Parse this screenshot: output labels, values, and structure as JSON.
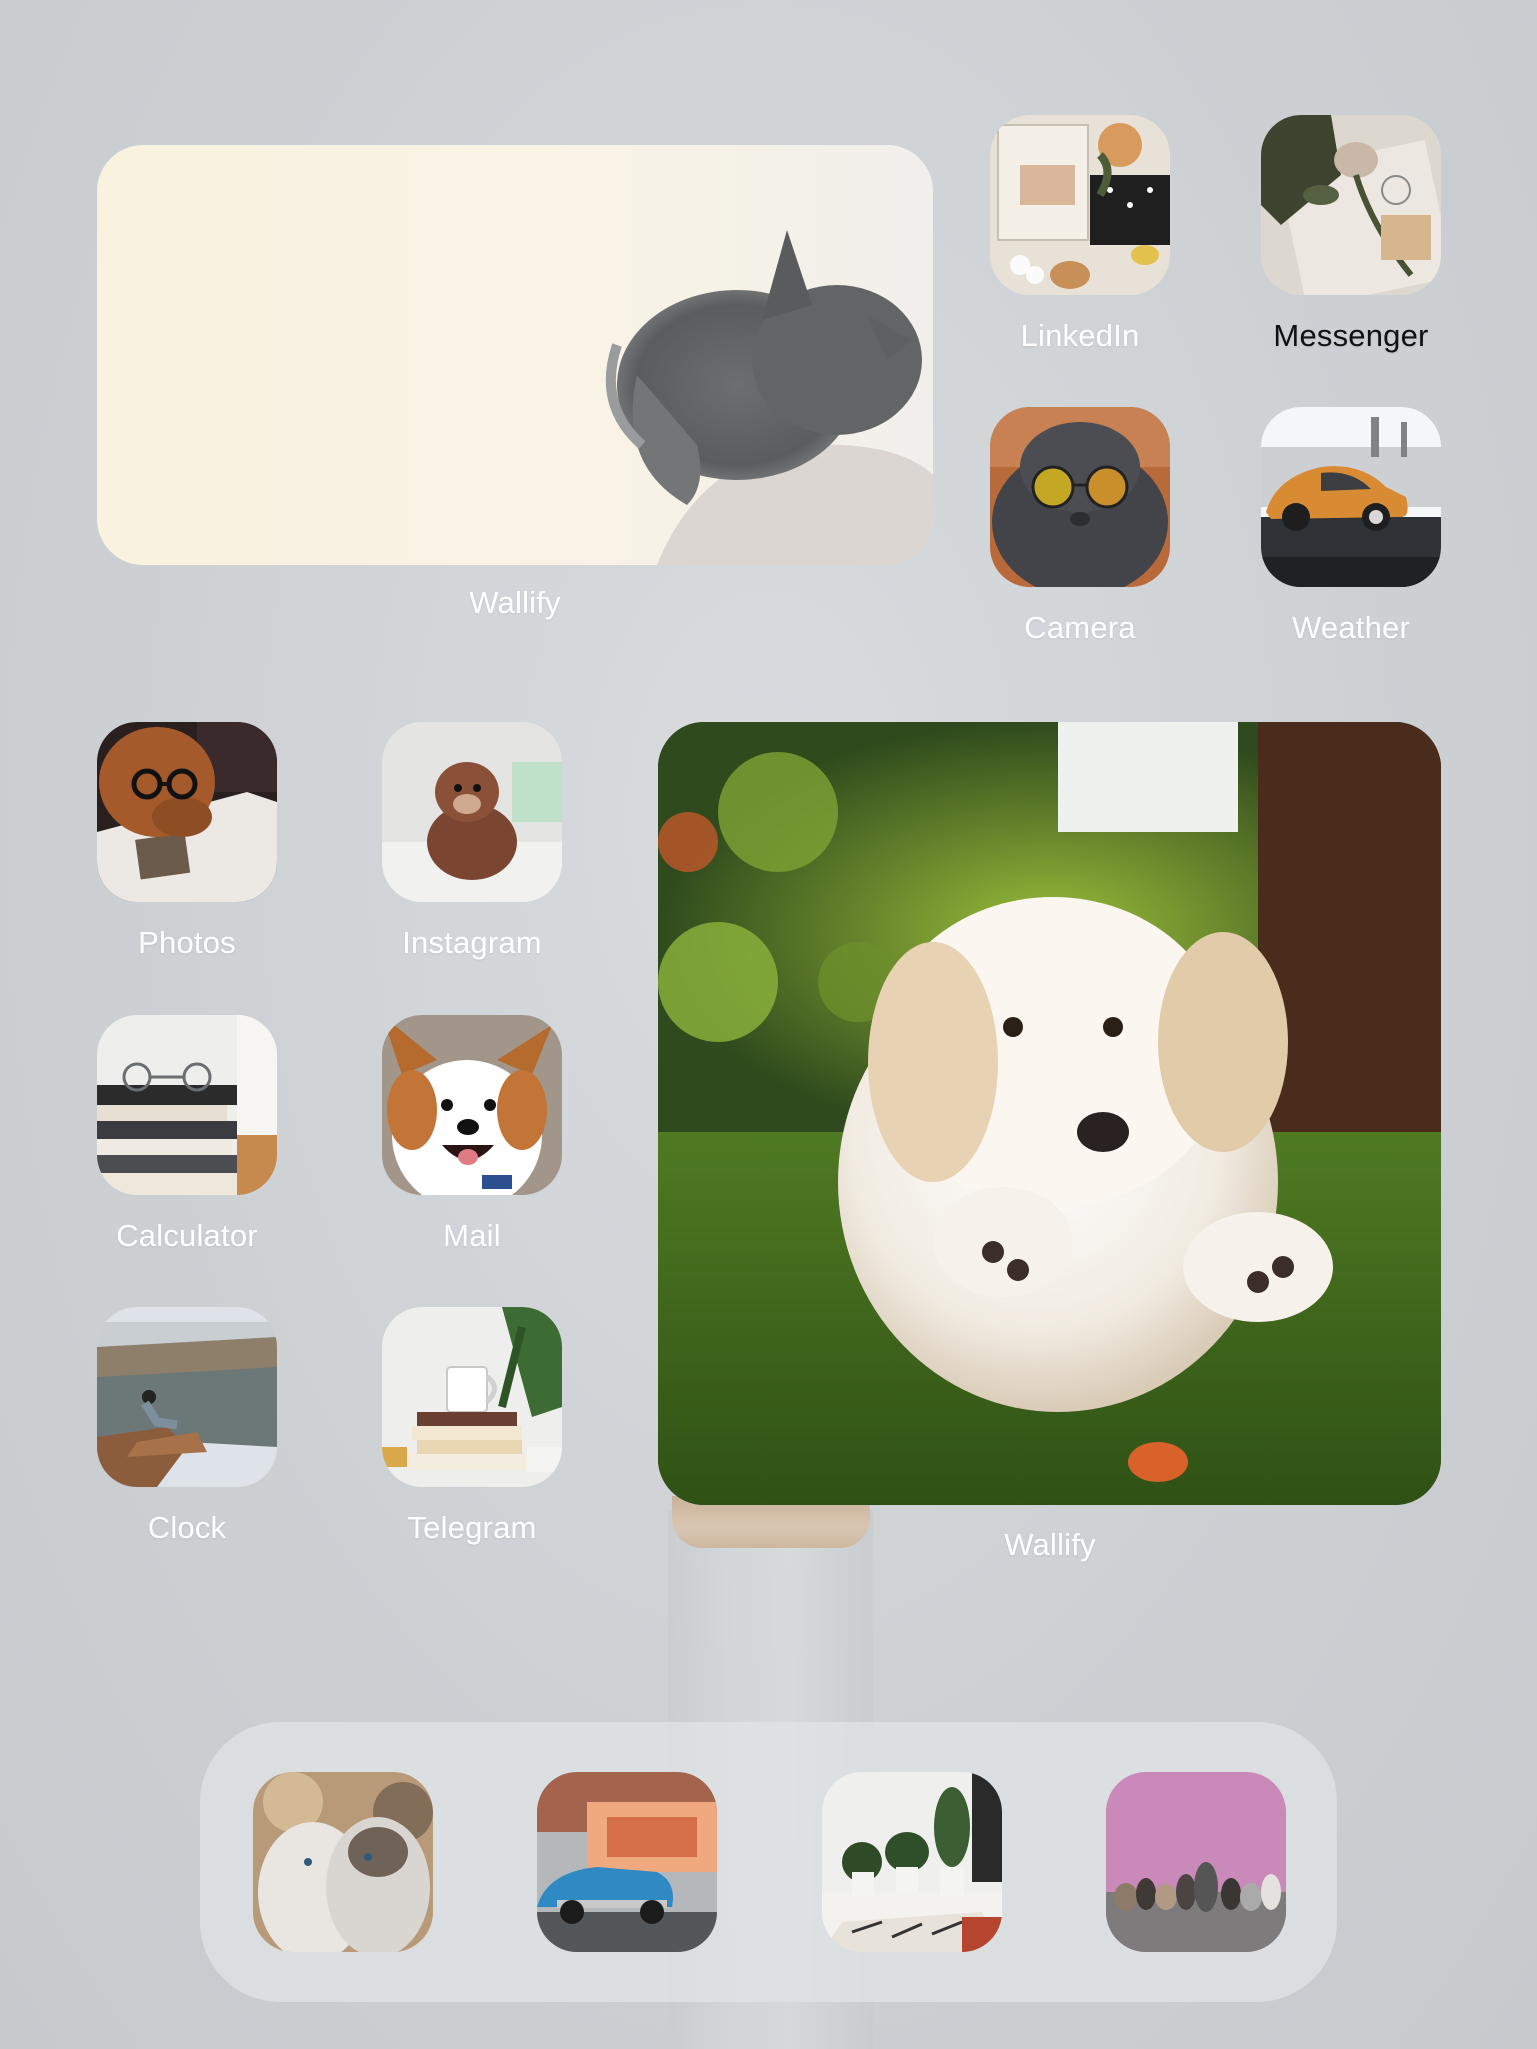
{
  "home_screen": {
    "widgets": [
      {
        "label": "Wallify",
        "image": "grey-kitten-in-hand-photo"
      },
      {
        "label": "Wallify",
        "image": "white-puppy-running-on-grass-photo"
      }
    ],
    "apps": [
      {
        "label": "LinkedIn",
        "image": "desk-flatlay-photo"
      },
      {
        "label": "Messenger",
        "image": "roses-and-notebook-photo"
      },
      {
        "label": "Camera",
        "image": "cat-with-sunglasses-photo"
      },
      {
        "label": "Weather",
        "image": "orange-beetle-car-photo"
      },
      {
        "label": "Photos",
        "image": "dog-with-glasses-reading-photo"
      },
      {
        "label": "Instagram",
        "image": "brown-poodle-puppy-photo"
      },
      {
        "label": "Calculator",
        "image": "books-and-glasses-photo"
      },
      {
        "label": "Mail",
        "image": "smiling-shiba-dog-photo"
      },
      {
        "label": "Clock",
        "image": "canyon-overlook-photo"
      },
      {
        "label": "Telegram",
        "image": "mug-on-books-photo"
      }
    ],
    "dock": [
      {
        "image": "two-cats-photo"
      },
      {
        "image": "blue-classic-car-photo"
      },
      {
        "image": "house-plants-photo"
      },
      {
        "image": "dogs-pink-wall-photo"
      }
    ]
  },
  "colors": {
    "wallpaper": "#cfd3d6",
    "label": "#ffffff",
    "label_dark": "#111111"
  }
}
